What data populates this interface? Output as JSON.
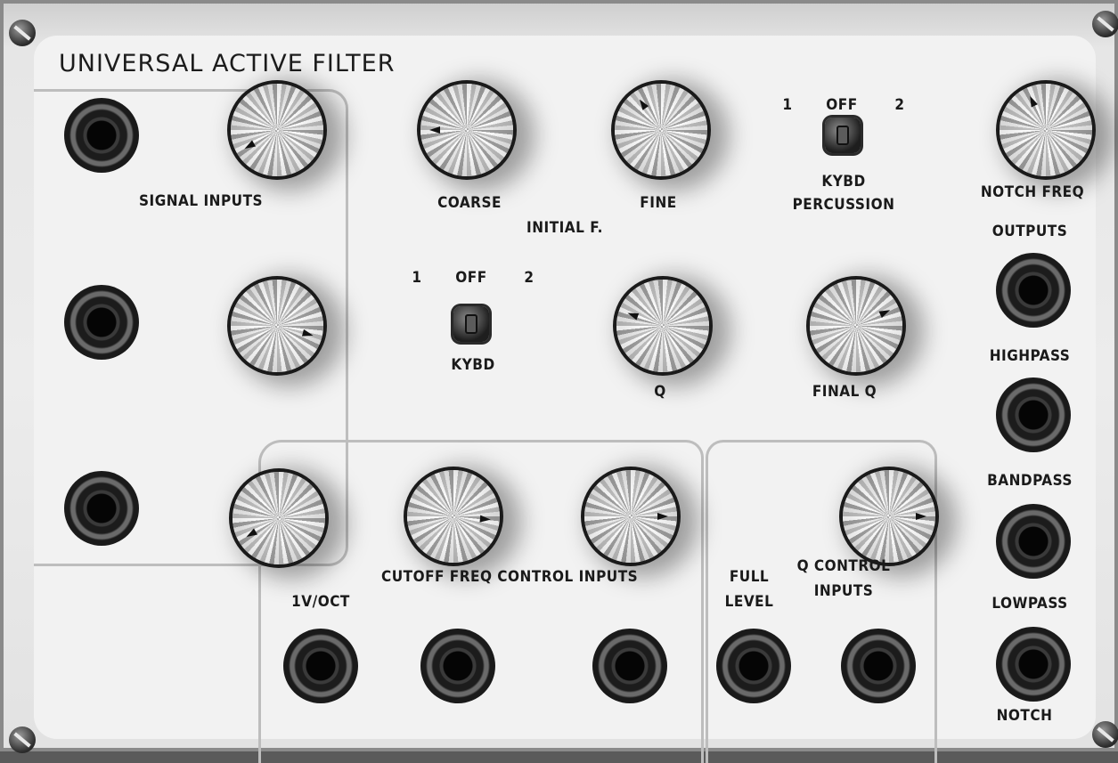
{
  "panel": {
    "title": "UNIVERSAL ACTIVE FILTER"
  },
  "labels": {
    "signal_inputs": "SIGNAL INPUTS",
    "coarse": "COARSE",
    "fine": "FINE",
    "initial_f": "INITIAL F.",
    "perc_switch_1": "1",
    "perc_switch_off": "OFF",
    "perc_switch_2": "2",
    "kybd_percussion_line1": "KYBD",
    "kybd_percussion_line2": "PERCUSSION",
    "notch_freq": "NOTCH FREQ",
    "outputs": "OUTPUTS",
    "kybd_switch_1": "1",
    "kybd_switch_off": "OFF",
    "kybd_switch_2": "2",
    "kybd": "KYBD",
    "q": "Q",
    "final_q": "FINAL Q",
    "highpass": "HIGHPASS",
    "bandpass": "BANDPASS",
    "cutoff_freq_control_inputs": "CUTOFF FREQ CONTROL INPUTS",
    "one_v_oct": "1V/OCT",
    "full_level_line1": "FULL",
    "full_level_line2": "LEVEL",
    "q_control_line1": "Q CONTROL",
    "q_control_line2": "INPUTS",
    "lowpass": "LOWPASS",
    "notch": "NOTCH"
  }
}
